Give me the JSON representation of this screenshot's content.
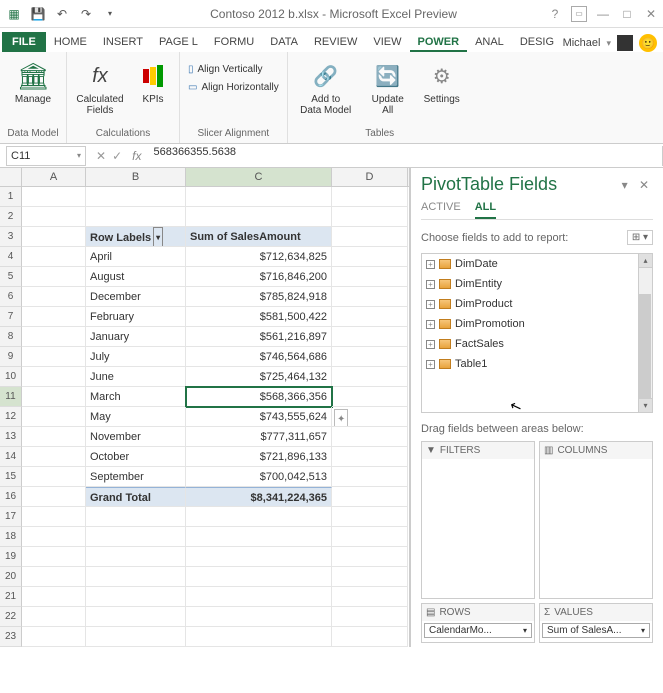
{
  "window_title": "Contoso 2012 b.xlsx - Microsoft Excel Preview",
  "user": {
    "name": "Michael"
  },
  "ribbon_tabs": [
    "FILE",
    "HOME",
    "INSERT",
    "PAGE L",
    "FORMU",
    "DATA",
    "REVIEW",
    "VIEW",
    "POWER",
    "ANAL",
    "DESIG"
  ],
  "active_tab": "POWER",
  "ribbon": {
    "data_model": {
      "manage": "Manage",
      "group": "Data Model"
    },
    "calculations": {
      "calc_fields": "Calculated\nFields",
      "kpis": "KPIs",
      "group": "Calculations"
    },
    "slicer": {
      "align_v": "Align Vertically",
      "align_h": "Align Horizontally",
      "group": "Slicer Alignment"
    },
    "tables": {
      "add": "Add to\nData Model",
      "update": "Update\nAll",
      "settings": "Settings",
      "group": "Tables"
    }
  },
  "name_box": "C11",
  "formula_value": "568366355.5638",
  "columns": [
    "A",
    "B",
    "C",
    "D"
  ],
  "pivot_headers": {
    "row_labels": "Row Labels",
    "value_col": "Sum of SalesAmount"
  },
  "pivot_rows": [
    {
      "label": "April",
      "value": "$712,634,825"
    },
    {
      "label": "August",
      "value": "$716,846,200"
    },
    {
      "label": "December",
      "value": "$785,824,918"
    },
    {
      "label": "February",
      "value": "$581,500,422"
    },
    {
      "label": "January",
      "value": "$561,216,897"
    },
    {
      "label": "July",
      "value": "$746,564,686"
    },
    {
      "label": "June",
      "value": "$725,464,132"
    },
    {
      "label": "March",
      "value": "$568,366,356"
    },
    {
      "label": "May",
      "value": "$743,555,624"
    },
    {
      "label": "November",
      "value": "$777,311,657"
    },
    {
      "label": "October",
      "value": "$721,896,133"
    },
    {
      "label": "September",
      "value": "$700,042,513"
    }
  ],
  "grand_total": {
    "label": "Grand Total",
    "value": "$8,341,224,365"
  },
  "selected_cell_row": 11,
  "pivot_pane": {
    "title": "PivotTable Fields",
    "tabs": [
      "ACTIVE",
      "ALL"
    ],
    "active_tab": "ALL",
    "hint": "Choose fields to add to report:",
    "fields": [
      "DimDate",
      "DimEntity",
      "DimProduct",
      "DimPromotion",
      "FactSales",
      "Table1"
    ],
    "drag_hint": "Drag fields between areas below:",
    "areas": {
      "filters": "FILTERS",
      "columns": "COLUMNS",
      "rows": "ROWS",
      "values": "VALUES",
      "rows_chip": "CalendarMo...",
      "values_chip": "Sum of SalesA..."
    }
  }
}
